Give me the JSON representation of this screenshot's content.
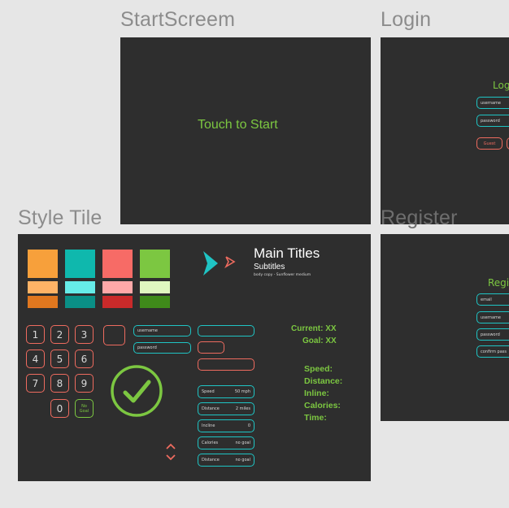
{
  "frames": {
    "start": {
      "label": "StartScreem",
      "touch_text": "Touch to Start"
    },
    "login": {
      "label": "Login",
      "title": "Logi",
      "fields": [
        "username",
        "password"
      ],
      "guest_button": "Guest"
    },
    "register": {
      "label": "Register",
      "title": "Regis",
      "fields": [
        "email",
        "username",
        "password",
        "confirm pass"
      ]
    },
    "style_tile": {
      "label": "Style Tile",
      "main_titles": "Main Titles",
      "subtitles": "Subtitles",
      "body_copy": "body copy - Sunflower medium",
      "keypad": [
        "1",
        "2",
        "3",
        "4",
        "5",
        "6",
        "7",
        "8",
        "9",
        "0"
      ],
      "no_goal": "No\nGoal",
      "inputs": [
        "username",
        "password"
      ],
      "stats": [
        {
          "label": "Speed",
          "value": "50 mph"
        },
        {
          "label": "Distance",
          "value": "2 miles"
        },
        {
          "label": "Incline",
          "value": "0"
        },
        {
          "label": "Calories",
          "value": "no goal"
        },
        {
          "label": "Distance",
          "value": "no goal"
        }
      ],
      "current": "Current: XX",
      "goal": "Goal: XX",
      "metrics": [
        "Speed:",
        "Distance:",
        "Inline:",
        "Calories:",
        "Time:"
      ]
    }
  },
  "colors": {
    "frame_bg": "#2e2e2e",
    "canvas_bg": "#e6e6e6",
    "green": "#7cc741",
    "teal": "#1fc4c4",
    "coral": "#ee6b5f",
    "palette": [
      [
        "#f7a03b",
        "#ffb366",
        "#e0771f"
      ],
      [
        "#0fb8ad",
        "#66ece8",
        "#0a8f86"
      ],
      [
        "#f76b66",
        "#ffa8a8",
        "#c92a2a"
      ],
      [
        "#7cc741",
        "#e0f7c0",
        "#3f8a1a"
      ]
    ]
  },
  "icons": [
    "chevron-right-icon",
    "chevron-small-icon",
    "check-circle-icon",
    "chevron-up-icon",
    "chevron-down-icon"
  ]
}
